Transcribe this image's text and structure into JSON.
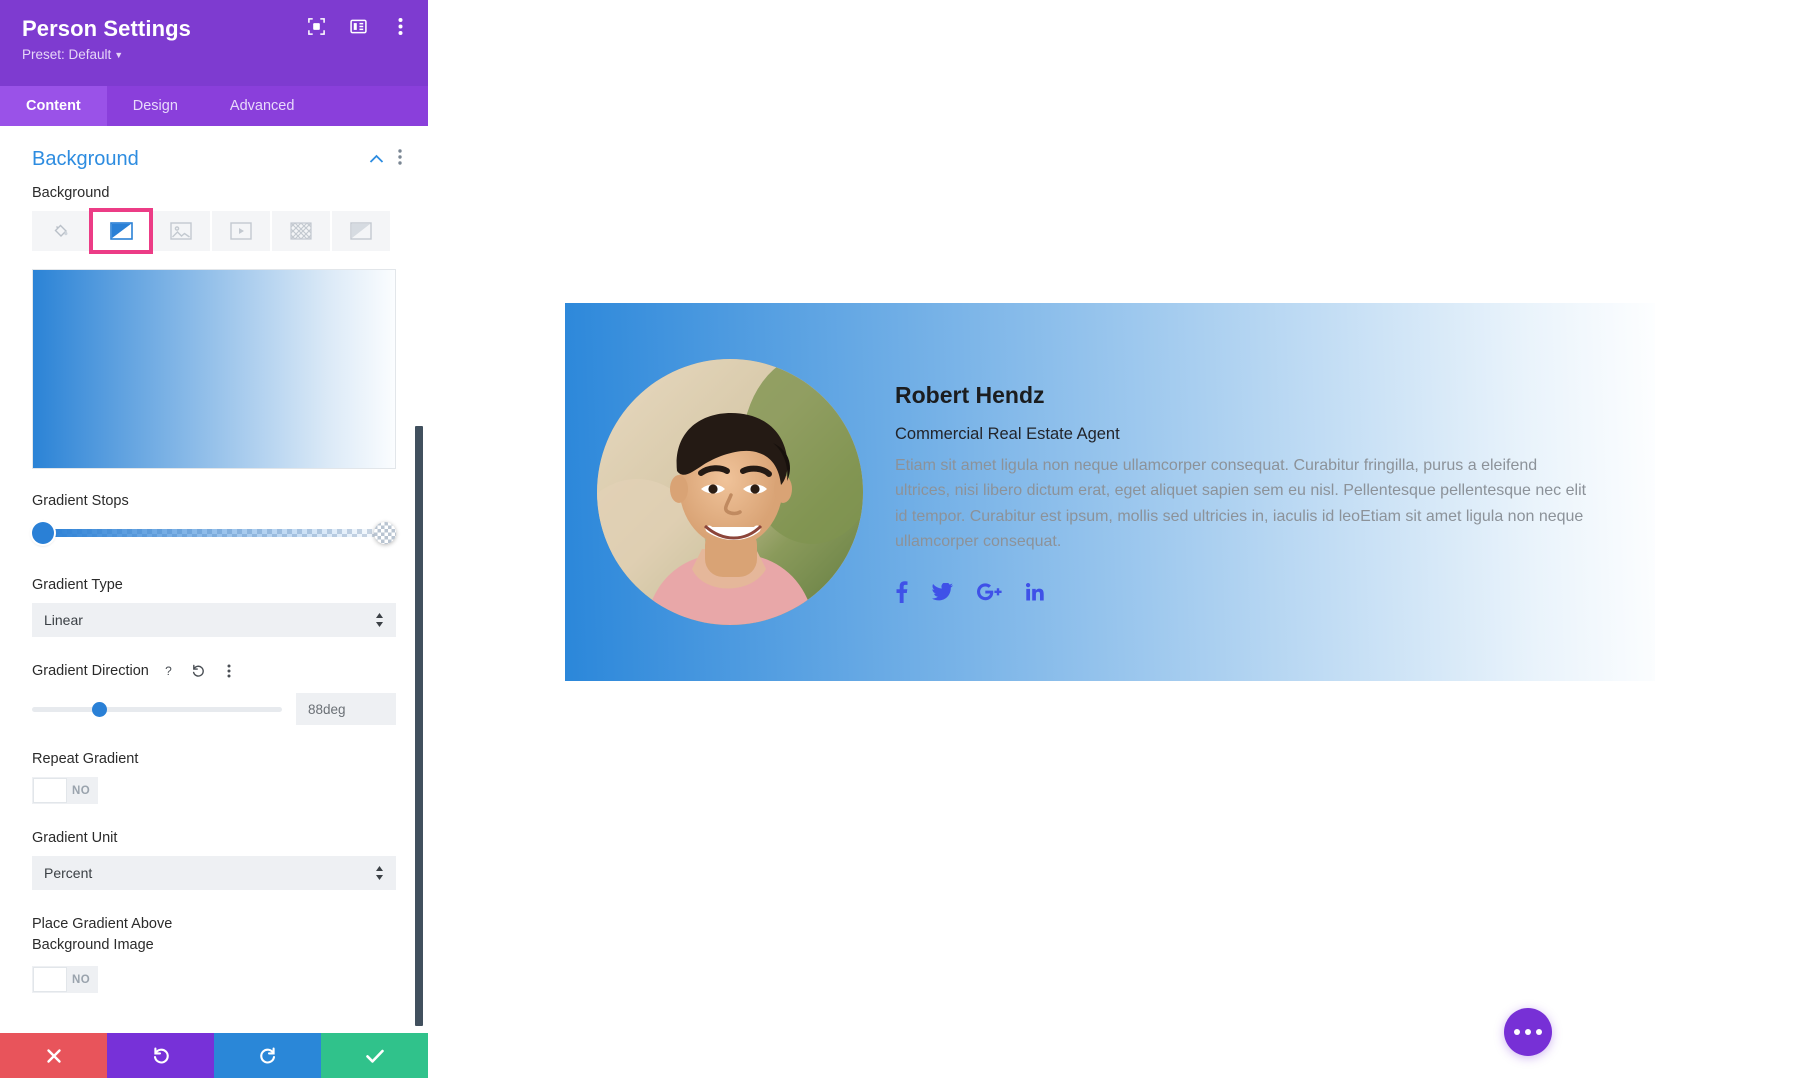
{
  "panel": {
    "title": "Person Settings",
    "preset_label": "Preset: Default",
    "header_icons": [
      {
        "name": "focus-target-icon"
      },
      {
        "name": "layout-panel-icon"
      },
      {
        "name": "kebab-menu-icon"
      }
    ],
    "tabs": [
      {
        "label": "Content",
        "active": true
      },
      {
        "label": "Design",
        "active": false
      },
      {
        "label": "Advanced",
        "active": false
      }
    ],
    "section": {
      "title": "Background",
      "collapse_icon": "chevron-up-icon",
      "options_icon": "kebab-menu-icon"
    },
    "fields": {
      "background_label": "Background",
      "background_types": [
        {
          "name": "background-color-tab",
          "icon": "paint-bucket-icon",
          "selected": false
        },
        {
          "name": "background-gradient-tab",
          "icon": "gradient-icon",
          "selected": true
        },
        {
          "name": "background-image-tab",
          "icon": "image-icon",
          "selected": false
        },
        {
          "name": "background-video-tab",
          "icon": "video-icon",
          "selected": false
        },
        {
          "name": "background-pattern-tab",
          "icon": "pattern-icon",
          "selected": false
        },
        {
          "name": "background-mask-tab",
          "icon": "mask-icon",
          "selected": false
        }
      ],
      "gradient_preview_css": "linear-gradient(90deg, #2b83d6 0%, #dceaf7 82%, #fbfdff 100%)",
      "gradient_stops_label": "Gradient Stops",
      "gradient_stops": [
        {
          "name": "gradient-stop-left",
          "position_percent": 0,
          "color": "#2a80d6"
        },
        {
          "name": "gradient-stop-right",
          "position_percent": 100,
          "color": "transparent"
        }
      ],
      "gradient_type_label": "Gradient Type",
      "gradient_type_value": "Linear",
      "gradient_direction_label": "Gradient Direction",
      "gradient_direction_value": "88deg",
      "gradient_direction_slider_percent": 24,
      "gradient_direction_help_icon": "question-mark-icon",
      "gradient_direction_reset_icon": "reset-arrow-icon",
      "gradient_direction_more_icon": "kebab-menu-icon",
      "repeat_gradient_label": "Repeat Gradient",
      "repeat_gradient_value": "NO",
      "gradient_unit_label": "Gradient Unit",
      "gradient_unit_value": "Percent",
      "place_gradient_label_line1": "Place Gradient Above",
      "place_gradient_label_line2": "Background Image",
      "place_gradient_value": "NO"
    },
    "actions": [
      {
        "name": "discard-button",
        "icon": "close-x-icon",
        "color": "#e8545b"
      },
      {
        "name": "undo-button",
        "icon": "undo-arrow-icon",
        "color": "#7731d8"
      },
      {
        "name": "redo-button",
        "icon": "redo-arrow-icon",
        "color": "#2a87d8"
      },
      {
        "name": "save-button",
        "icon": "checkmark-icon",
        "color": "#30c28b"
      }
    ],
    "accent_colors": {
      "header_purple": "#7e3bd0",
      "tabs_purple": "#8a3fdb",
      "section_blue": "#2d8ce0",
      "highlight_pink": "#ec3c86"
    }
  },
  "canvas": {
    "person": {
      "name": "Robert Hendz",
      "role": "Commercial Real Estate Agent",
      "bio": "Etiam sit amet ligula non neque ullamcorper consequat. Curabitur fringilla, purus a eleifend ultrices, nisi libero dictum erat, eget aliquet sapien sem eu nisl. Pellentesque pellentesque nec elit id tempor. Curabitur est ipsum, mollis sed ultricies in, iaculis id leoEtiam sit amet ligula non neque ullamcorper consequat.",
      "avatar_alt": "smiling-man-portrait",
      "socials": [
        {
          "name": "facebook-icon",
          "label": "f"
        },
        {
          "name": "twitter-icon",
          "label": ""
        },
        {
          "name": "google-plus-icon",
          "label": "G+"
        },
        {
          "name": "linkedin-icon",
          "label": "in"
        }
      ],
      "card_background_css": "linear-gradient(88deg, #2b87da 0%, #e9f3fb 88%, #fdfeff 100%)",
      "social_color": "#3f51e8"
    },
    "fab": {
      "name": "page-options-fab",
      "icon": "three-dots-icon"
    }
  }
}
